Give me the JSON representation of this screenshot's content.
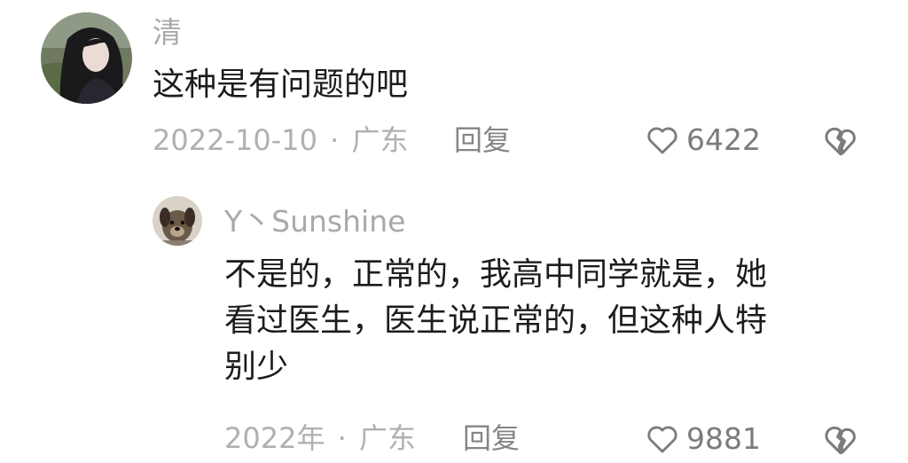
{
  "comments": [
    {
      "username": "清",
      "text": "这种是有问题的吧",
      "date": "2022-10-10",
      "location": "广东",
      "reply_label": "回复",
      "likes": "6422",
      "avatar": "avatar-girl-dark-hair"
    },
    {
      "username": "Y丶Sunshine",
      "text_lines": [
        "不是的，正常的，我高中同学就是，她",
        "看过医生，医生说正常的，但这种人特",
        "别少"
      ],
      "date": "2022年",
      "location": "广东",
      "reply_label": "回复",
      "likes": "9881",
      "avatar": "avatar-dog"
    }
  ],
  "separator": "·",
  "icons": {
    "like": "heart-outline-icon",
    "dislike": "broken-heart-icon"
  },
  "colors": {
    "username": "#a9a9a9",
    "content": "#1c1c1c",
    "meta": "#b0b0b0",
    "icon": "#7c7c7c"
  }
}
